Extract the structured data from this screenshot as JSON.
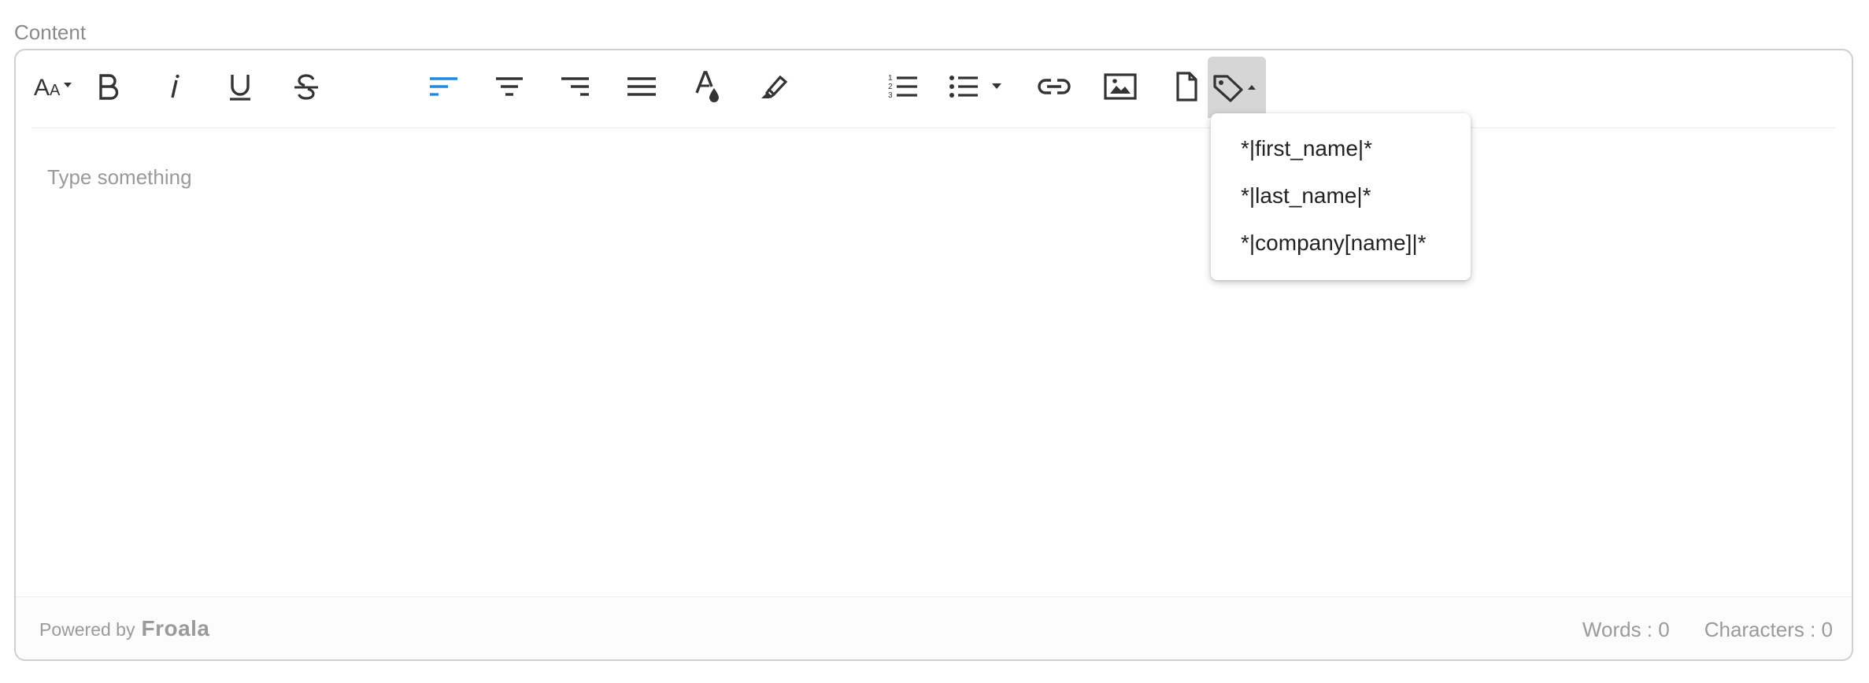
{
  "field_label": "Content",
  "toolbar": {
    "buttons": [
      {
        "name": "font-size-button",
        "icon": "font-size-icon"
      },
      {
        "name": "bold-button",
        "icon": "bold-icon"
      },
      {
        "name": "italic-button",
        "icon": "italic-icon"
      },
      {
        "name": "underline-button",
        "icon": "underline-icon"
      },
      {
        "name": "strikethrough-button",
        "icon": "strikethrough-icon"
      },
      {
        "name": "align-left-button",
        "icon": "align-left-icon",
        "active_color": "#1e88e5"
      },
      {
        "name": "align-center-button",
        "icon": "align-center-icon"
      },
      {
        "name": "align-right-button",
        "icon": "align-right-icon"
      },
      {
        "name": "align-justify-button",
        "icon": "align-justify-icon"
      },
      {
        "name": "text-color-button",
        "icon": "text-color-icon"
      },
      {
        "name": "highlight-button",
        "icon": "highlighter-icon"
      },
      {
        "name": "ordered-list-button",
        "icon": "ordered-list-icon"
      },
      {
        "name": "unordered-list-button",
        "icon": "unordered-list-icon"
      },
      {
        "name": "insert-link-button",
        "icon": "link-icon"
      },
      {
        "name": "insert-image-button",
        "icon": "image-icon"
      },
      {
        "name": "insert-file-button",
        "icon": "file-icon"
      },
      {
        "name": "merge-tags-button",
        "icon": "tag-icon",
        "state": "open"
      }
    ]
  },
  "editor": {
    "placeholder": "Type something"
  },
  "merge_tags_menu": {
    "items": [
      "*|first_name|*",
      "*|last_name|*",
      "*|company[name]|*"
    ]
  },
  "footer": {
    "powered_by": "Powered by",
    "brand": "Froala",
    "words": "Words : 0",
    "characters": "Characters : 0"
  },
  "colors": {
    "accent": "#1e88e5",
    "icon": "#333333",
    "muted_text": "#9a9a9a",
    "border": "#cfcfcf"
  }
}
